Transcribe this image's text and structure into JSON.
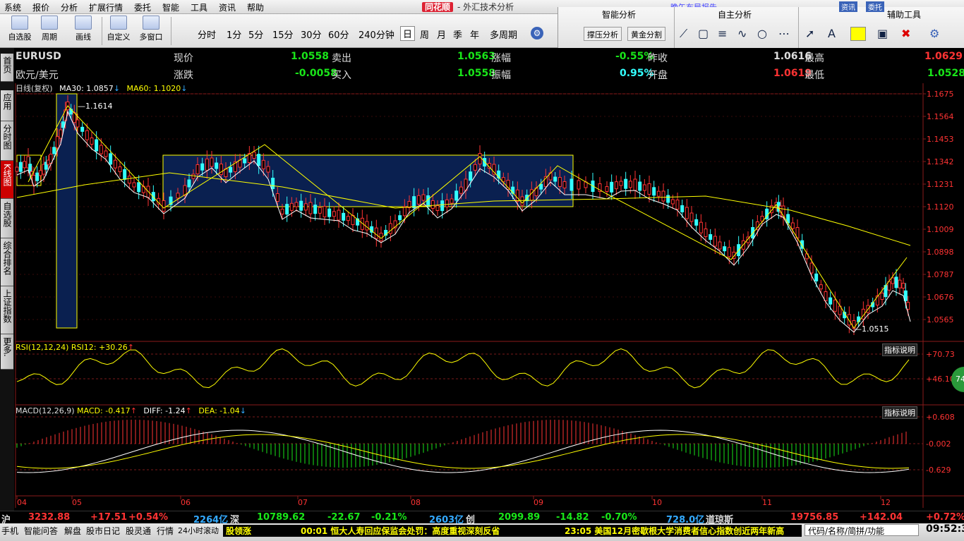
{
  "menu": [
    "系统",
    "报价",
    "分析",
    "扩展行情",
    "委托",
    "智能",
    "工具",
    "资讯",
    "帮助"
  ],
  "app": {
    "logo": "同花顺",
    "subtitle": "- 外汇技术分析"
  },
  "ticker_top": "晚午布局报告",
  "toolbar": {
    "buttons": [
      "自选股",
      "周期",
      "画线",
      "自定义",
      "多窗口"
    ],
    "periods": [
      "分时",
      "1分",
      "5分",
      "15分",
      "30分",
      "60分",
      "240分钟",
      "日",
      "周",
      "月",
      "季",
      "年",
      "多周期"
    ],
    "active_period": "日"
  },
  "rpanel": {
    "headers": [
      "智能分析",
      "自主分析",
      "辅助工具"
    ],
    "buttons": [
      "撑压分析",
      "黄金分割"
    ],
    "right_mini": [
      "资讯",
      "委托"
    ]
  },
  "lefttabs": [
    "首页",
    "应用",
    "分时图",
    "K线图",
    "自选股",
    "综合排名",
    "上证指数",
    "更多."
  ],
  "quote": {
    "symbol": "EURUSD",
    "name": "欧元/美元",
    "row1": [
      {
        "l": "现价",
        "v": "1.0558"
      },
      {
        "l": "卖出",
        "v": "1.0563"
      },
      {
        "l": "涨幅",
        "v": "-0.55%"
      },
      {
        "l": "昨收",
        "v": "1.0616"
      },
      {
        "l": "最高",
        "v": "1.0629"
      }
    ],
    "row2": [
      {
        "l": "涨跌",
        "v": "-0.0058"
      },
      {
        "l": "买入",
        "v": "1.0558"
      },
      {
        "l": "振幅",
        "v": "0.95%"
      },
      {
        "l": "开盘",
        "v": "1.0619"
      },
      {
        "l": "最低",
        "v": "1.0528"
      }
    ]
  },
  "ma_legend": {
    "label": "日线(复权)",
    "ma30": "MA30: 1.0857",
    "ma60": "MA60: 1.1020"
  },
  "rsi_legend": "RSI(12,12,24) RSI12: +30.26",
  "macd_legend": {
    "label": "MACD(12,26,9)",
    "macd": "MACD: -0.417",
    "diff": "DIFF: -1.24",
    "dea": "DEA: -1.04"
  },
  "desc_btn": "指标说明",
  "chart_data": {
    "type": "candlestick",
    "price_ticks": [
      "1.1675",
      "1.1564",
      "1.1453",
      "1.1342",
      "1.1231",
      "1.1120",
      "1.1009",
      "1.0898",
      "1.0787",
      "1.0676",
      "1.0565"
    ],
    "ylim": [
      1.0515,
      1.1675
    ],
    "rsi_ticks": [
      "+70.73",
      "+46.10"
    ],
    "macd_ticks": [
      "+0.608",
      "-0.002",
      "-0.629"
    ],
    "x_labels": [
      "04",
      "05",
      "06",
      "07",
      "08",
      "09",
      "10",
      "11",
      "12"
    ],
    "annotations": {
      "high": "1.1614",
      "low": "1.0515"
    }
  },
  "round_btn": "74",
  "bottom": {
    "sh": {
      "n": "沪",
      "v": "3232.88",
      "c": "+17.51",
      "p": "+0.54%",
      "vol": "2264亿"
    },
    "sz": {
      "n": "深",
      "v": "10789.62",
      "c": "-22.67",
      "p": "-0.21%",
      "vol": "2603亿"
    },
    "cy": {
      "n": "创",
      "v": "2099.89",
      "c": "-14.82",
      "p": "-0.70%",
      "vol": "728.0亿"
    },
    "dj": {
      "n": "道琼斯",
      "v": "19756.85",
      "c": "+142.04",
      "p": "+0.72%"
    }
  },
  "statusbar": {
    "items": [
      "手机",
      "智能问答",
      "解盘",
      "股市日记",
      "股灵通",
      "行情",
      "24小时滚动"
    ],
    "news1": "股领涨",
    "news2": "00:01 恒大人寿回应保监会处罚：高度重视深刻反省",
    "news3": "23:05 美国12月密歇根大学消费者信心指数创近两年新高",
    "search": "代码/名称/简拼/功能",
    "clock": "09:52:33"
  }
}
